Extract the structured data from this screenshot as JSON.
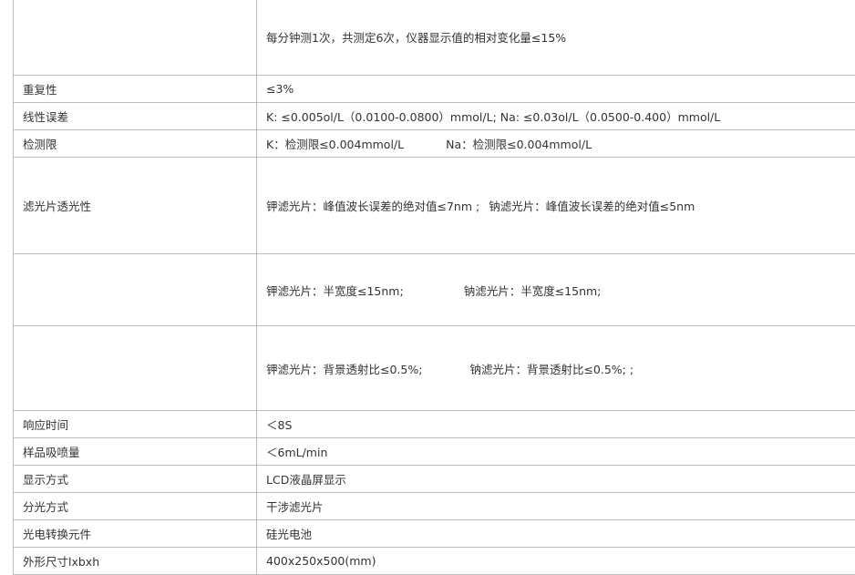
{
  "rows": [
    {
      "label": "",
      "value": "每分钟测1次，共测定6次，仪器显示值的相对变化量≤15%"
    },
    {
      "label": "重复性",
      "value": "≤3%"
    },
    {
      "label": "线性误差",
      "value": "K:   ≤0.005ol/L（0.0100-0.0800）mmol/L;  Na:   ≤0.03ol/L（0.0500-0.400）mmol/L"
    },
    {
      "label": "检测限",
      "value_parts": [
        "K：检测限≤0.004mmol/L",
        "Na：检测限≤0.004mmol/L"
      ]
    },
    {
      "label": "滤光片透光性",
      "value_parts": [
        "钾滤光片：峰值波长误差的绝对值≤7nm    ;",
        "钠滤光片：峰值波长误差的绝对值≤5nm"
      ]
    },
    {
      "label": "",
      "value_parts": [
        "钾滤光片：半宽度≤15nm;",
        "钠滤光片：半宽度≤15nm;"
      ]
    },
    {
      "label": "",
      "value_parts": [
        "钾滤光片：背景透射比≤0.5%;",
        "钠滤光片：背景透射比≤0.5%;  ;"
      ]
    },
    {
      "label": "响应时间",
      "value": "＜8S"
    },
    {
      "label": "样品吸喷量",
      "value": "＜6mL/min"
    },
    {
      "label": "显示方式",
      "value": "LCD液晶屏显示"
    },
    {
      "label": "分光方式",
      "value": "干涉滤光片"
    },
    {
      "label": "光电转换元件",
      "value": "硅光电池"
    },
    {
      "label": "外形尺寸lxbxh",
      "value": "400x250x500(mm)"
    }
  ]
}
